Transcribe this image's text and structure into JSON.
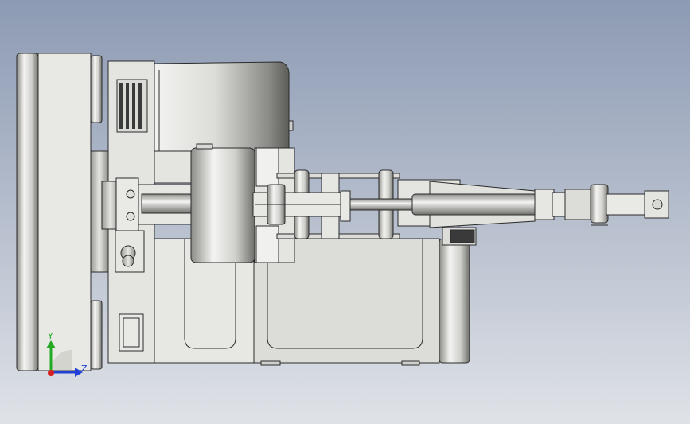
{
  "viewport": {
    "background_top": "#8c9ab3",
    "background_bottom": "#dfe2e7"
  },
  "model": {
    "metal_light": "#ececea",
    "metal_mid": "#d7d7d2",
    "metal_dark": "#6e6e6a",
    "edge": "#2b2b2b",
    "slot_dark": "#3a3a3a"
  },
  "triad": {
    "y_label": "Y",
    "z_label": "Z",
    "y_color": "#22aa22",
    "z_color": "#1f3fd6",
    "x_color": "#d62020"
  }
}
